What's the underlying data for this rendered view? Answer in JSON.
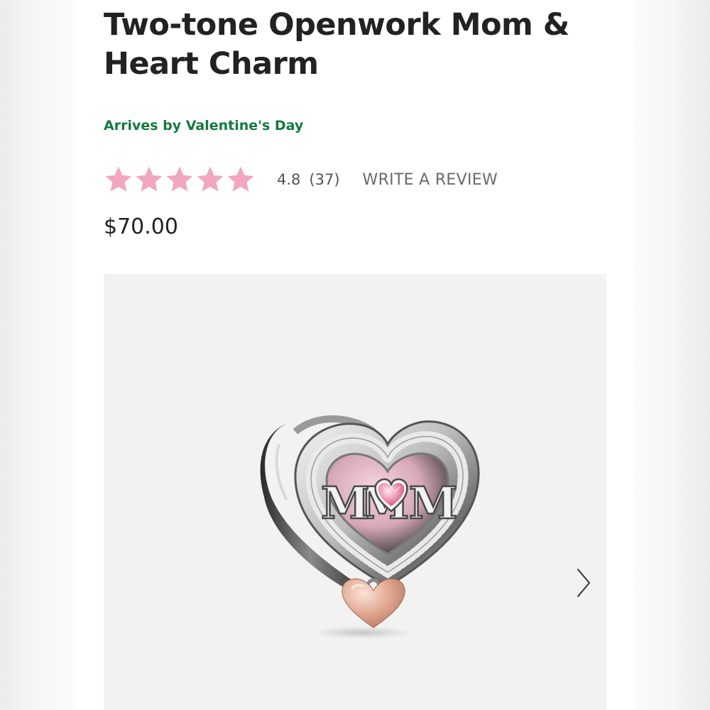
{
  "product": {
    "title": "Two-tone Openwork Mom & Heart Charm",
    "arrival": "Arrives by Valentine's Day",
    "price": "$70.00",
    "charm_lettering": "MOM"
  },
  "rating": {
    "value": "4.8",
    "count": "(37)",
    "stars_filled": 5,
    "star_color": "#f2a7bf",
    "write_review_label": "WRITE A REVIEW"
  },
  "colors": {
    "arrival_text": "#137a3c",
    "title_text": "#222222",
    "gallery_bg": "#f2f2f2"
  },
  "gallery": {
    "next_icon": "chevron-right-icon"
  }
}
